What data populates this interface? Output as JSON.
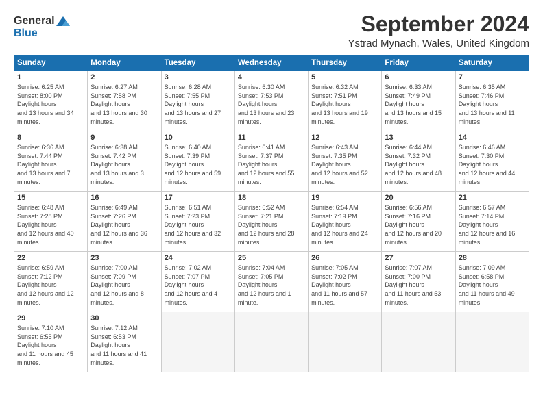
{
  "logo": {
    "general": "General",
    "blue": "Blue"
  },
  "title": "September 2024",
  "location": "Ystrad Mynach, Wales, United Kingdom",
  "weekdays": [
    "Sunday",
    "Monday",
    "Tuesday",
    "Wednesday",
    "Thursday",
    "Friday",
    "Saturday"
  ],
  "days": [
    {
      "day": "",
      "empty": true
    },
    {
      "day": "",
      "empty": true
    },
    {
      "day": "",
      "empty": true
    },
    {
      "day": "",
      "empty": true
    },
    {
      "day": "",
      "empty": true
    },
    {
      "day": "",
      "empty": true
    },
    {
      "day": "7",
      "rise": "6:35 AM",
      "set": "7:46 PM",
      "daylight": "13 hours and 11 minutes."
    },
    {
      "day": "1",
      "rise": "6:25 AM",
      "set": "8:00 PM",
      "daylight": "13 hours and 34 minutes."
    },
    {
      "day": "2",
      "rise": "6:27 AM",
      "set": "7:58 PM",
      "daylight": "13 hours and 30 minutes."
    },
    {
      "day": "3",
      "rise": "6:28 AM",
      "set": "7:55 PM",
      "daylight": "13 hours and 27 minutes."
    },
    {
      "day": "4",
      "rise": "6:30 AM",
      "set": "7:53 PM",
      "daylight": "13 hours and 23 minutes."
    },
    {
      "day": "5",
      "rise": "6:32 AM",
      "set": "7:51 PM",
      "daylight": "13 hours and 19 minutes."
    },
    {
      "day": "6",
      "rise": "6:33 AM",
      "set": "7:49 PM",
      "daylight": "13 hours and 15 minutes."
    },
    {
      "day": "7",
      "rise": "6:35 AM",
      "set": "7:46 PM",
      "daylight": "13 hours and 11 minutes."
    },
    {
      "day": "8",
      "rise": "6:36 AM",
      "set": "7:44 PM",
      "daylight": "13 hours and 7 minutes."
    },
    {
      "day": "9",
      "rise": "6:38 AM",
      "set": "7:42 PM",
      "daylight": "13 hours and 3 minutes."
    },
    {
      "day": "10",
      "rise": "6:40 AM",
      "set": "7:39 PM",
      "daylight": "12 hours and 59 minutes."
    },
    {
      "day": "11",
      "rise": "6:41 AM",
      "set": "7:37 PM",
      "daylight": "12 hours and 55 minutes."
    },
    {
      "day": "12",
      "rise": "6:43 AM",
      "set": "7:35 PM",
      "daylight": "12 hours and 52 minutes."
    },
    {
      "day": "13",
      "rise": "6:44 AM",
      "set": "7:32 PM",
      "daylight": "12 hours and 48 minutes."
    },
    {
      "day": "14",
      "rise": "6:46 AM",
      "set": "7:30 PM",
      "daylight": "12 hours and 44 minutes."
    },
    {
      "day": "15",
      "rise": "6:48 AM",
      "set": "7:28 PM",
      "daylight": "12 hours and 40 minutes."
    },
    {
      "day": "16",
      "rise": "6:49 AM",
      "set": "7:26 PM",
      "daylight": "12 hours and 36 minutes."
    },
    {
      "day": "17",
      "rise": "6:51 AM",
      "set": "7:23 PM",
      "daylight": "12 hours and 32 minutes."
    },
    {
      "day": "18",
      "rise": "6:52 AM",
      "set": "7:21 PM",
      "daylight": "12 hours and 28 minutes."
    },
    {
      "day": "19",
      "rise": "6:54 AM",
      "set": "7:19 PM",
      "daylight": "12 hours and 24 minutes."
    },
    {
      "day": "20",
      "rise": "6:56 AM",
      "set": "7:16 PM",
      "daylight": "12 hours and 20 minutes."
    },
    {
      "day": "21",
      "rise": "6:57 AM",
      "set": "7:14 PM",
      "daylight": "12 hours and 16 minutes."
    },
    {
      "day": "22",
      "rise": "6:59 AM",
      "set": "7:12 PM",
      "daylight": "12 hours and 12 minutes."
    },
    {
      "day": "23",
      "rise": "7:00 AM",
      "set": "7:09 PM",
      "daylight": "12 hours and 8 minutes."
    },
    {
      "day": "24",
      "rise": "7:02 AM",
      "set": "7:07 PM",
      "daylight": "12 hours and 4 minutes."
    },
    {
      "day": "25",
      "rise": "7:04 AM",
      "set": "7:05 PM",
      "daylight": "12 hours and 1 minute."
    },
    {
      "day": "26",
      "rise": "7:05 AM",
      "set": "7:02 PM",
      "daylight": "11 hours and 57 minutes."
    },
    {
      "day": "27",
      "rise": "7:07 AM",
      "set": "7:00 PM",
      "daylight": "11 hours and 53 minutes."
    },
    {
      "day": "28",
      "rise": "7:09 AM",
      "set": "6:58 PM",
      "daylight": "11 hours and 49 minutes."
    },
    {
      "day": "29",
      "rise": "7:10 AM",
      "set": "6:55 PM",
      "daylight": "11 hours and 45 minutes."
    },
    {
      "day": "30",
      "rise": "7:12 AM",
      "set": "6:53 PM",
      "daylight": "11 hours and 41 minutes."
    }
  ]
}
